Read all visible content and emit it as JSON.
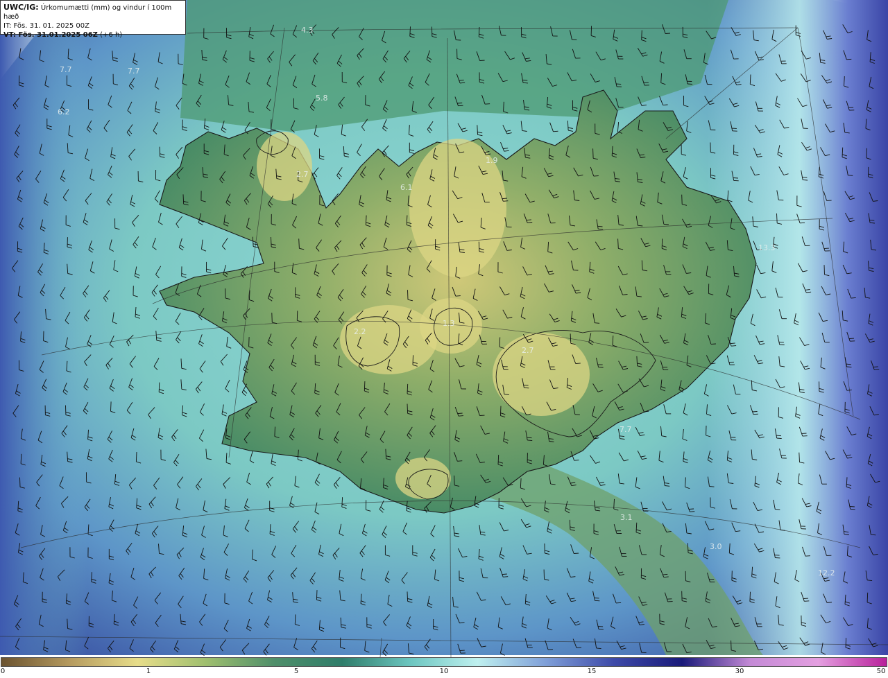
{
  "header": {
    "model": "UWC/IG:",
    "title": "Úrkomumætti (mm) og vindur í 100m hæð",
    "initial_time": "IT: Fös. 31. 01. 2025 00Z",
    "valid_time_label": "VT: Fös. 31.01.2025 06Z",
    "valid_time_offset": "(+6 h)"
  },
  "map_labels": [
    {
      "id": "label-1",
      "text": "4.3"
    },
    {
      "id": "label-2",
      "text": "7.7"
    },
    {
      "id": "label-3",
      "text": "7.7"
    },
    {
      "id": "label-4",
      "text": "6.2"
    },
    {
      "id": "label-5",
      "text": "5.8"
    },
    {
      "id": "label-6",
      "text": "2.7"
    },
    {
      "id": "label-7",
      "text": "6.1"
    },
    {
      "id": "label-8",
      "text": "1.9"
    },
    {
      "id": "label-9",
      "text": "13.3"
    },
    {
      "id": "label-10",
      "text": "2.2"
    },
    {
      "id": "label-11",
      "text": "1.3"
    },
    {
      "id": "label-12",
      "text": "2.7"
    },
    {
      "id": "label-13",
      "text": "7.7"
    },
    {
      "id": "label-14",
      "text": "3.1"
    },
    {
      "id": "label-15",
      "text": "3.0"
    },
    {
      "id": "label-16",
      "text": "12.2"
    }
  ],
  "colorbar": {
    "unit": "mm",
    "ticks": [
      "0",
      "1",
      "5",
      "10",
      "15",
      "30",
      "50"
    ],
    "colors": [
      "#6b5330",
      "#b59a5e",
      "#e7dd8a",
      "#9fbf6e",
      "#4f8f6a",
      "#2f7d6a",
      "#6cc6c0",
      "#bff0ef",
      "#7f9fd8",
      "#3e4aa8",
      "#1a1a7a",
      "#c48ad6",
      "#e49fe0",
      "#b8209a"
    ]
  },
  "colors": {
    "sea_low": "#3b4b9f",
    "sea_mid": "#8fd8d6",
    "land_green": "#3f8a66",
    "highland_yellow": "#d9d27f",
    "coast_line": "#1a1a1a"
  }
}
